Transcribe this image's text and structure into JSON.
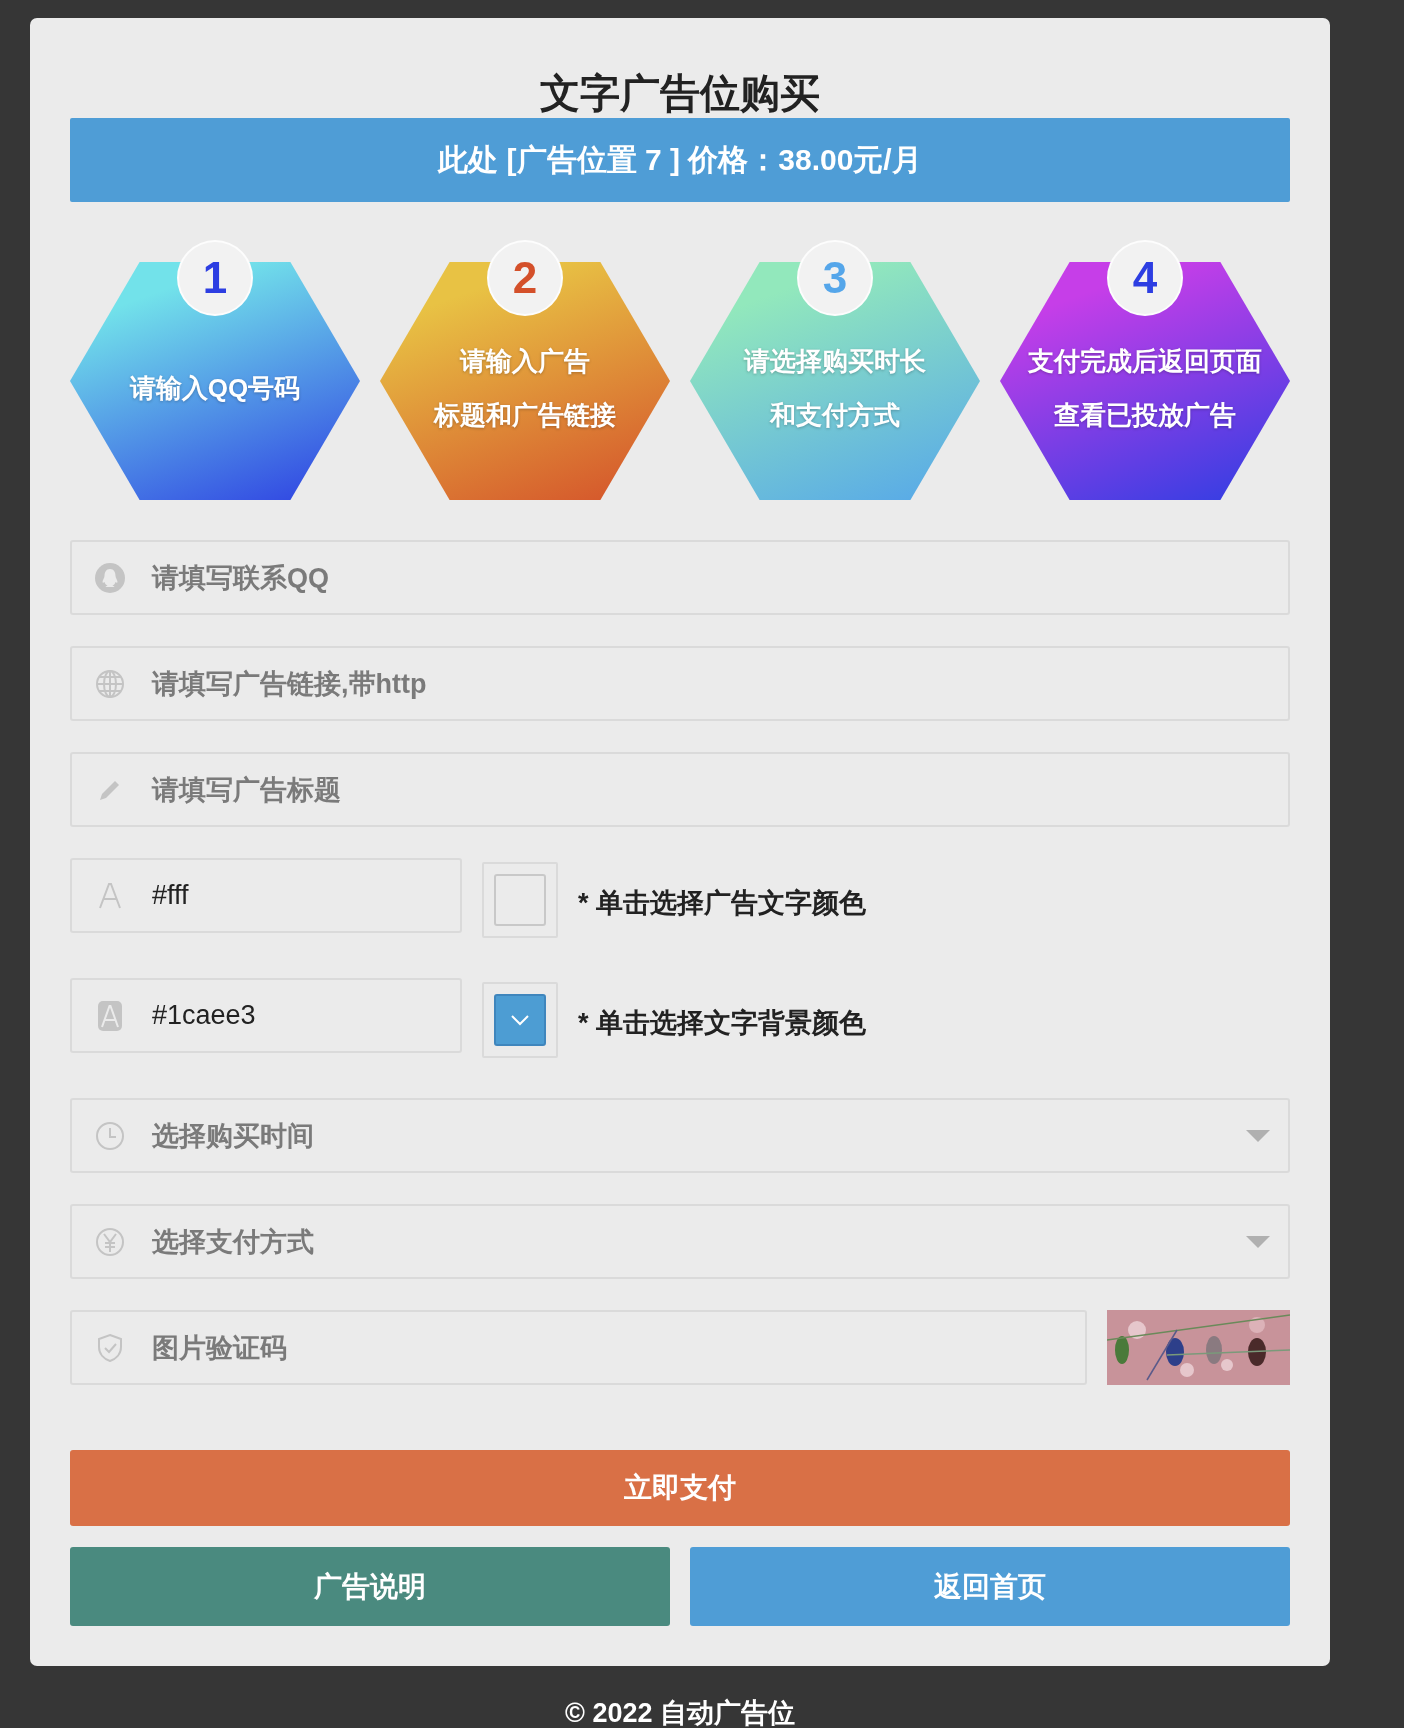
{
  "title": "文字广告位购买",
  "banner": {
    "text": "此处 [广告位置 7 ] 价格：38.00元/月"
  },
  "steps": [
    {
      "number": "1",
      "lines": [
        "请输入QQ号码"
      ],
      "color": "#72e2ea",
      "kind": "cool"
    },
    {
      "number": "2",
      "lines": [
        "请输入广告",
        "标题和广告链接"
      ],
      "color": "#e8c244",
      "kind": "warm"
    },
    {
      "number": "3",
      "lines": [
        "请选择购买时长",
        "和支付方式"
      ],
      "color": "#92e8bc",
      "kind": "sky"
    },
    {
      "number": "4",
      "lines": [
        "支付完成后返回页面",
        "查看已投放广告"
      ],
      "color": "#c63ee8",
      "kind": "cool"
    }
  ],
  "qq_field": {
    "placeholder": "请填写联系QQ"
  },
  "link_field": {
    "placeholder": "请填写广告链接,带http"
  },
  "title_field": {
    "placeholder": "请填写广告标题"
  },
  "text_color": {
    "value": "#fff",
    "color": "#ebebeb",
    "kind": "empty",
    "hint": "* 单击选择广告文字颜色"
  },
  "background_color": {
    "value": "#1caee3",
    "color": "#4d9dd3",
    "kind": "filled",
    "hint": "* 单击选择文字背景颜色"
  },
  "duration_select": {
    "placeholder": "选择购买时间"
  },
  "payment_select": {
    "placeholder": "选择支付方式"
  },
  "captcha_field": {
    "placeholder": "图片验证码"
  },
  "pay_button": {
    "label": "立即支付"
  },
  "info_button": {
    "label": "广告说明"
  },
  "home_button": {
    "label": "返回首页"
  },
  "footer": {
    "text": "© 2022 自动广告位"
  }
}
